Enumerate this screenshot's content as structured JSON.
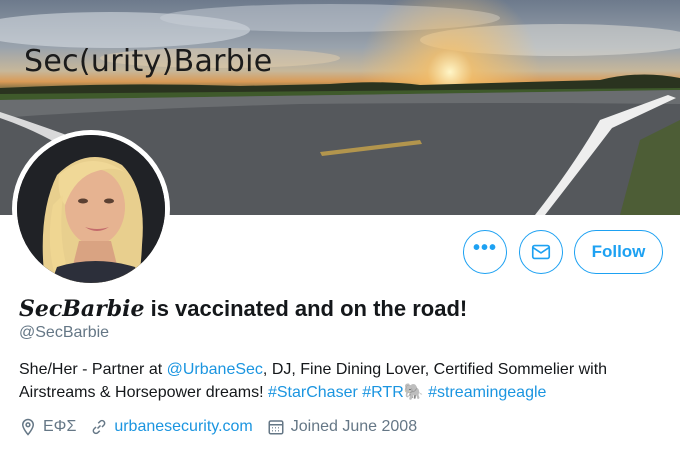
{
  "banner": {
    "title": "Sec(urity)Barbie"
  },
  "profile": {
    "display_name_styled": "𝑺𝒆𝒄𝑩𝒂𝒓𝒃𝒊𝒆",
    "display_name_rest": " is vaccinated and on the road!",
    "handle": "@SecBarbie",
    "bio_prefix": "She/Her - Partner at ",
    "bio_mention": "@UrbaneSec",
    "bio_middle": ", DJ, Fine Dining Lover, Certified Sommelier with Airstreams & Horsepower dreams! ",
    "bio_tag1": "#StarChaser",
    "bio_tag2": "#RTR",
    "bio_emoji": "🐘",
    "bio_tag3": "#streamingeagle",
    "location": "ΕΦΣ",
    "website": "urbanesecurity.com",
    "joined": "Joined June 2008"
  },
  "actions": {
    "more_label": "•••",
    "follow_label": "Follow"
  },
  "colors": {
    "accent": "#1da1f2",
    "link": "#1b95e0",
    "muted": "#657786",
    "text": "#14171a"
  },
  "icons": {
    "more": "more-icon",
    "message": "mail-icon",
    "location": "location-pin-icon",
    "website": "link-icon",
    "joined": "calendar-icon"
  }
}
